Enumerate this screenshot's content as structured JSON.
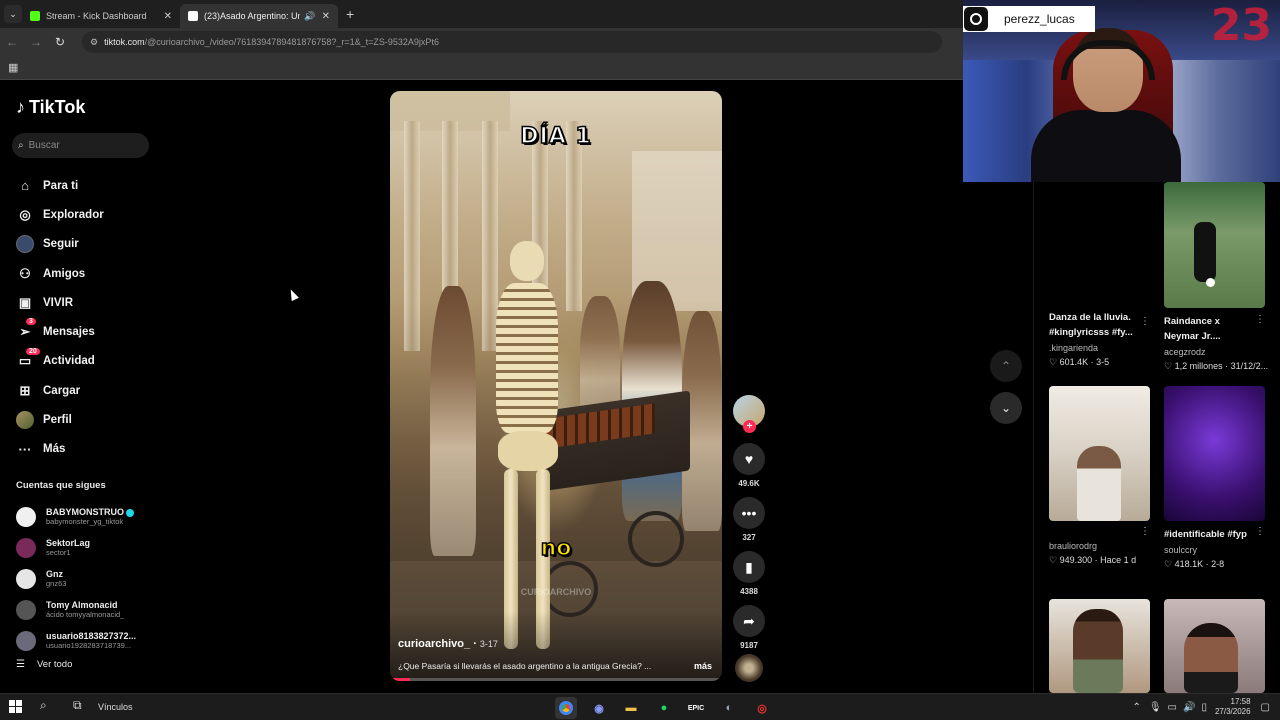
{
  "browser": {
    "tabs": [
      {
        "title": "Stream - Kick Dashboard",
        "favicon_color": "#53fc18",
        "active": false
      },
      {
        "title": "(23)Asado Argentino: Una ",
        "favicon_color": "#ffffff",
        "active": true
      }
    ],
    "url_host": "tiktok.com",
    "url_path": "/@curioarchivo_/video/7618394789481876758?_r=1&_t=ZS-9532A9jxPt6"
  },
  "tiktok": {
    "brand": "TikTok",
    "search_placeholder": "Buscar",
    "nav": [
      {
        "label": "Para ti",
        "icon": "home-icon",
        "badge": ""
      },
      {
        "label": "Explorador",
        "icon": "compass-icon",
        "badge": ""
      },
      {
        "label": "Seguir",
        "icon": "following-avatar-icon",
        "badge": ""
      },
      {
        "label": "Amigos",
        "icon": "friends-icon",
        "badge": ""
      },
      {
        "label": "VIVIR",
        "icon": "live-tv-icon",
        "badge": ""
      },
      {
        "label": "Mensajes",
        "icon": "send-icon",
        "badge": "3"
      },
      {
        "label": "Actividad",
        "icon": "activity-icon",
        "badge": "20"
      },
      {
        "label": "Cargar",
        "icon": "upload-icon",
        "badge": ""
      },
      {
        "label": "Perfil",
        "icon": "profile-avatar-icon",
        "badge": ""
      },
      {
        "label": "Más",
        "icon": "more-dots-icon",
        "badge": ""
      }
    ],
    "following_title": "Cuentas que sigues",
    "following": [
      {
        "name": "BABYMONSTRUO",
        "handle": "babymonster_yg_tiktok",
        "verified": true,
        "avatar_color": "#f0f0f0"
      },
      {
        "name": "SektorLag",
        "handle": "sector1",
        "verified": false,
        "avatar_color": "#7a2a5a"
      },
      {
        "name": "Gnz",
        "handle": "gnz63",
        "verified": false,
        "avatar_color": "#e6e6e6"
      },
      {
        "name": "Tomy Almonacid",
        "handle": "ácido tomyyalmonacid_",
        "verified": false,
        "avatar_color": "#555555"
      },
      {
        "name": "usuario8183827372...",
        "handle": "usuario1928283718739...",
        "verified": false,
        "avatar_color": "#6a6a7a"
      }
    ],
    "see_all": "Ver todo",
    "video": {
      "caption_top": "DÍA 1",
      "caption_mid": "no",
      "watermark": "CURIOARCHIVO",
      "author": "curioarchivo_",
      "date": "3-17",
      "description": "¿Que Pasaría si llevarás el asado argentino a la antigua Grecia? ...",
      "more": "más",
      "progress": 0.06
    },
    "actions": {
      "likes": "49.6K",
      "comments": "327",
      "saves": "4388",
      "shares": "9187"
    }
  },
  "overlay": {
    "instagram_handle": "perezz_lucas",
    "jersey_number": "23"
  },
  "recommendations": [
    {
      "title": "Danza de la lluvia. #kinglyricsss #fy...",
      "user": ".kingarienda",
      "likes": "601.4K",
      "date": "3-5"
    },
    {
      "title": "Raindance x Neymar Jr....",
      "user": "acegzrodz",
      "likes": "1,2 millones",
      "date": "31/12/2..."
    },
    {
      "title": "",
      "user": "brauliorodrg",
      "likes": "949.300",
      "date": "Hace 1 d"
    },
    {
      "title": "#identificable #fyp",
      "user": "soulccry",
      "likes": "418.1K",
      "date": "2-8"
    }
  ],
  "taskbar": {
    "label": "Vínculos",
    "time": "17:58",
    "date": "27/3/2026"
  },
  "colors": {
    "accent": "#fe2c55",
    "page_bg": "#000000"
  }
}
